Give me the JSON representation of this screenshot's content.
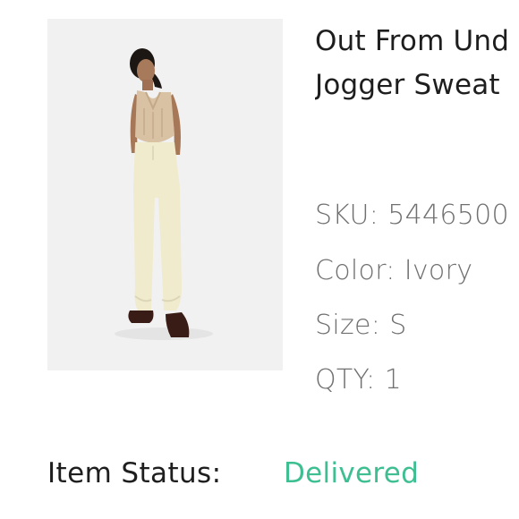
{
  "product": {
    "title_line1": "Out From Und",
    "title_line2": "Jogger Sweat",
    "image_icon": "product-photo-model-in-ivory-joggers"
  },
  "attributes": {
    "sku_label": "SKU:",
    "sku_value": "5446500",
    "color_label": "Color:",
    "color_value": "Ivory",
    "size_label": "Size:",
    "size_value": "S",
    "qty_label": "QTY:",
    "qty_value": "1"
  },
  "status": {
    "label": "Item Status:",
    "value": "Delivered",
    "value_color": "#3dbf91"
  }
}
